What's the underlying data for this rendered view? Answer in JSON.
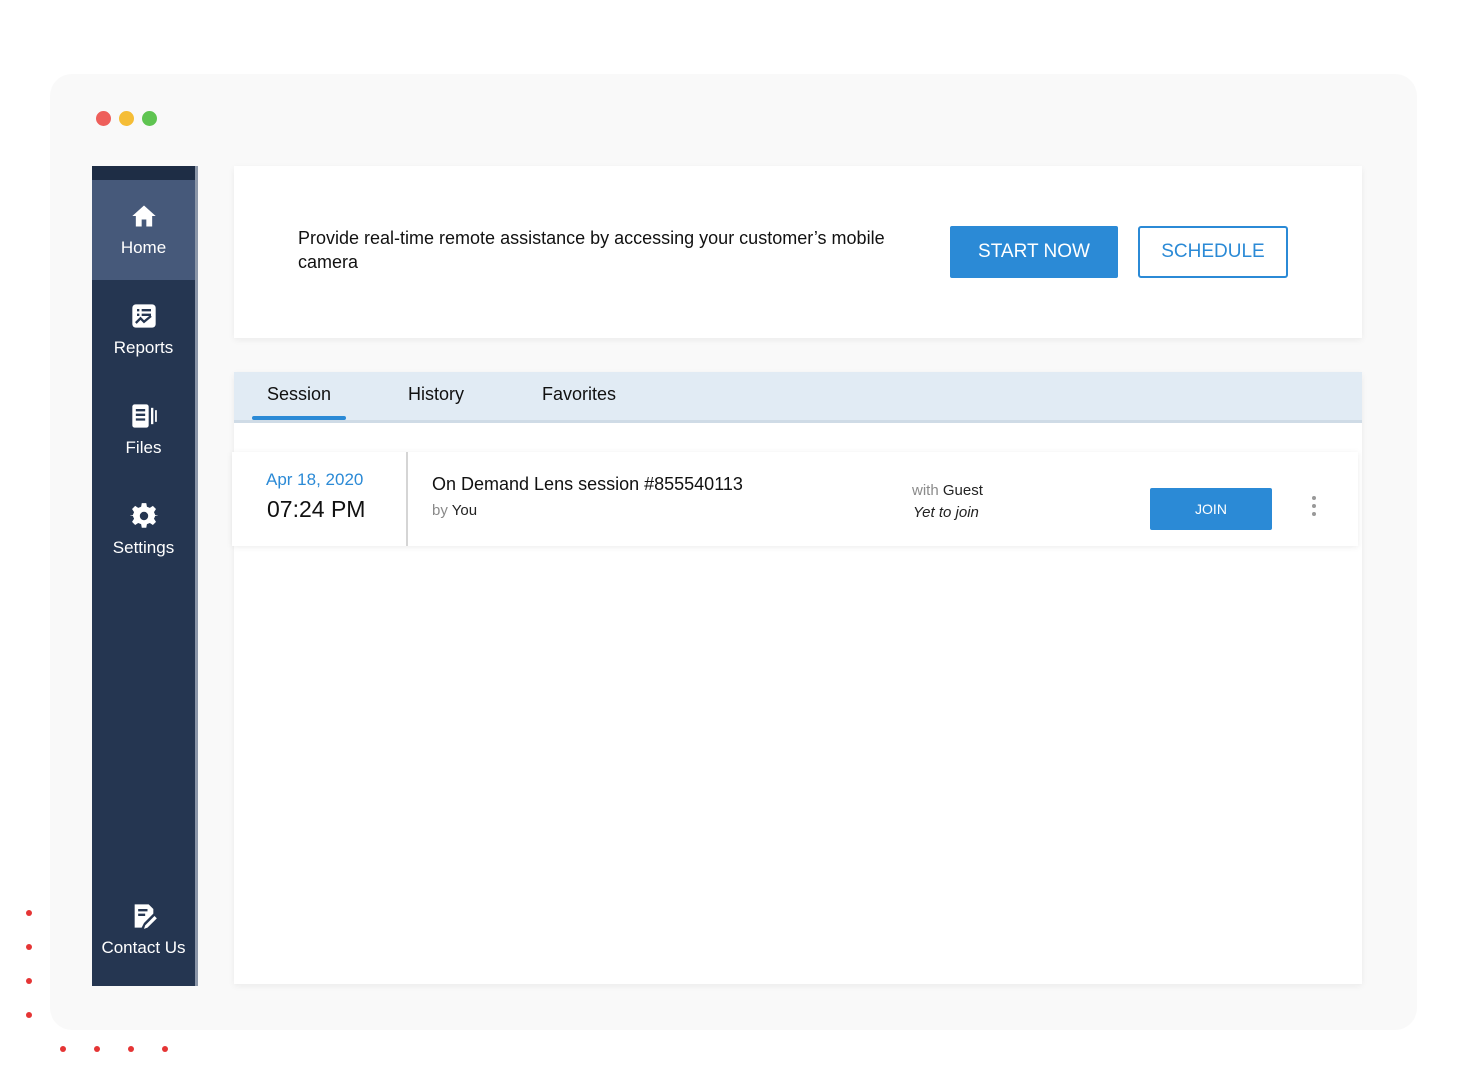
{
  "sidebar": {
    "items": [
      {
        "label": "Home",
        "icon": "home-icon",
        "active": true
      },
      {
        "label": "Reports",
        "icon": "reports-icon"
      },
      {
        "label": "Files",
        "icon": "files-icon"
      },
      {
        "label": "Settings",
        "icon": "gear-icon"
      }
    ],
    "footer_item": {
      "label": "Contact Us",
      "icon": "edit-note-icon"
    }
  },
  "hero": {
    "text": "Provide real-time remote assistance by accessing your customer’s mobile camera",
    "start_label": "START NOW",
    "schedule_label": "SCHEDULE"
  },
  "tabs": [
    {
      "label": "Session",
      "active": true
    },
    {
      "label": "History"
    },
    {
      "label": "Favorites"
    }
  ],
  "session": {
    "date": "Apr 18, 2020",
    "time": "07:24 PM",
    "title": "On Demand Lens session #855540113",
    "by_prefix": "by",
    "by_name": "You",
    "with_prefix": "with",
    "with_name": "Guest",
    "status": "Yet to join",
    "join_label": "JOIN"
  },
  "colors": {
    "accent": "#2b8ad6",
    "sidebar_bg": "#253651",
    "sidebar_active": "#46597a",
    "tabs_bg": "#e1ebf4"
  }
}
